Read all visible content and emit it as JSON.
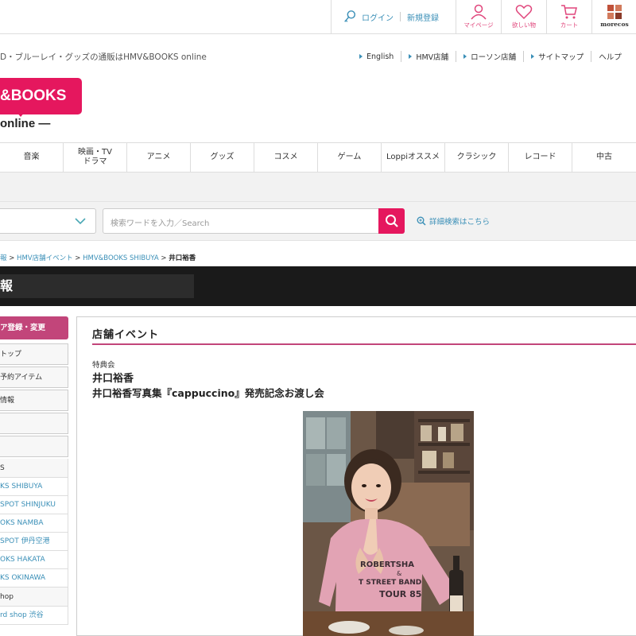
{
  "topbar": {
    "login": "ログイン",
    "register": "新規登録",
    "icons": [
      {
        "name": "mypage",
        "label": "マイページ",
        "icon": "person-icon"
      },
      {
        "name": "wishlist",
        "label": "欲しい物",
        "icon": "heart-icon"
      },
      {
        "name": "cart",
        "label": "カート",
        "icon": "cart-icon"
      },
      {
        "name": "morecos",
        "label": "morecos",
        "icon": "morecos-logo-icon"
      }
    ]
  },
  "header": {
    "tagline": "D・ブルーレイ・グッズの通販はHMV&BOOKS online",
    "links": [
      "English",
      "HMV店舗",
      "ローソン店舗",
      "サイトマップ",
      "ヘルプ"
    ],
    "logo_text": "&BOOKS",
    "logo_sub": "online —"
  },
  "nav": [
    "音楽",
    "映画・TV\nドラマ",
    "アニメ",
    "グッズ",
    "コスメ",
    "ゲーム",
    "Loppiオススメ",
    "クラシック",
    "レコード",
    "中古"
  ],
  "search": {
    "placeholder": "検索ワードを入力／Search",
    "advanced": "詳細検索はこちら"
  },
  "breadcrumb": {
    "items": [
      "報",
      "HMV店舗イベント",
      "HMV&BOOKS SHIBUYA"
    ],
    "current": "井口裕香"
  },
  "darkbar_title": "報",
  "sidebar": {
    "header": "ア登録・変更",
    "buttons": [
      "トップ",
      "予約アイテム",
      "情報",
      "",
      ""
    ],
    "category1": "S",
    "stores": [
      "KS SHIBUYA",
      "SPOT SHINJUKU",
      "OKS NAMBA",
      "SPOT 伊丹空港",
      "OKS HAKATA",
      "KS OKINAWA"
    ],
    "category2": "hop",
    "stores2": [
      "rd shop 渋谷"
    ]
  },
  "main": {
    "section_title": "店舗イベント",
    "event_type": "特典会",
    "artist": "井口裕香",
    "event_title": "井口裕香写真集『cappuccino』発売記念お渡し会",
    "photo_shirt_text": [
      "ROBERTSHA",
      "&",
      "T STREET BAND",
      "TOUR 85"
    ]
  },
  "colors": {
    "brand": "#e5175e",
    "accent": "#c2457a",
    "link": "#3a8fb7",
    "dark": "#1a1a1a"
  }
}
